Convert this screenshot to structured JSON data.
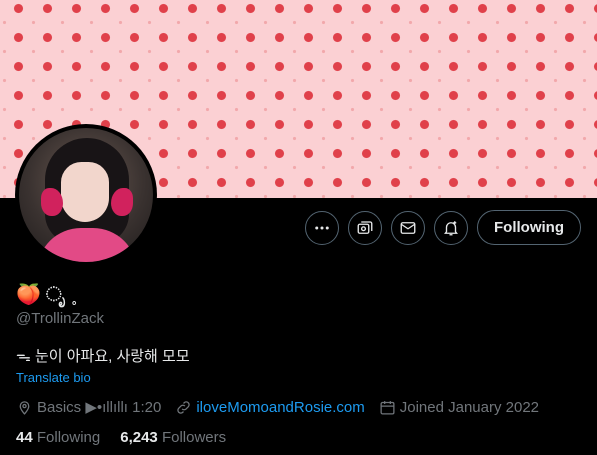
{
  "profile": {
    "display_name": "🍑 ೃ ˳",
    "handle": "@TrollinZack",
    "bio": "ᯓ 눈이 아파요, 사랑해 모모",
    "translate_label": "Translate bio",
    "location": "Basics ▶•ıllıllı 1:20",
    "website": "iloveMomoandRosie.com",
    "joined": "Joined January 2022",
    "following_count": "44",
    "following_label": "Following",
    "followers_count": "6,243",
    "followers_label": "Followers"
  },
  "actions": {
    "follow_button_label": "Following",
    "icons": [
      "more-icon",
      "subscriptions-icon",
      "message-icon",
      "notify-icon"
    ]
  },
  "colors": {
    "background": "#000000",
    "text_primary": "#e7e9ea",
    "text_secondary": "#71767b",
    "link": "#1d9bf0",
    "banner_pink": "#fbd0d3",
    "banner_peach": "#e0404a"
  }
}
